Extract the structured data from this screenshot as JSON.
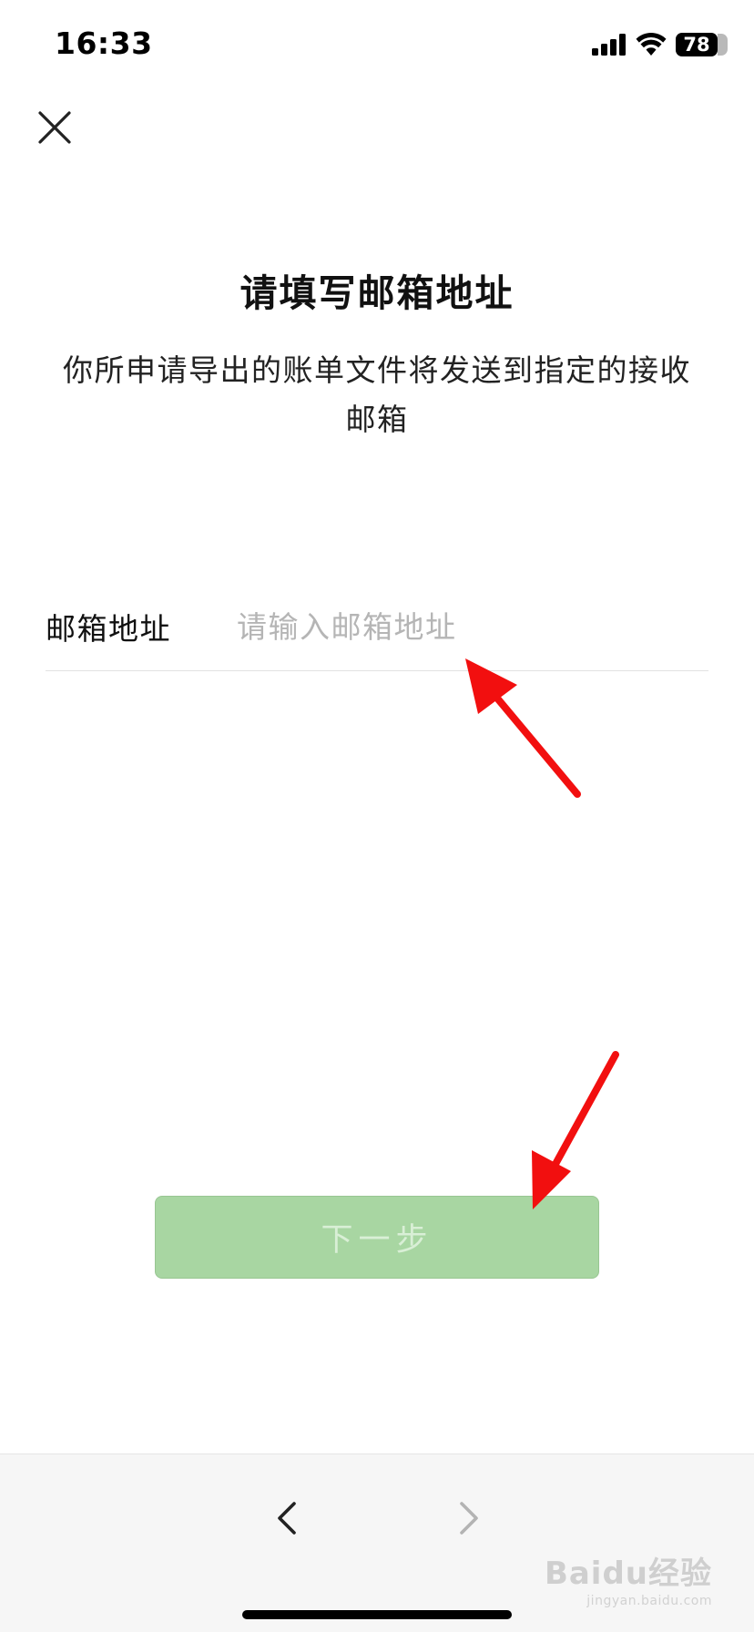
{
  "status_bar": {
    "time": "16:33",
    "battery": "78",
    "icons": [
      "cellular-signal-icon",
      "wifi-icon",
      "battery-icon"
    ]
  },
  "header": {
    "close_icon": "close-icon"
  },
  "title": "请填写邮箱地址",
  "description": "你所申请导出的账单文件将发送到指定的接收邮箱",
  "email_field": {
    "label": "邮箱地址",
    "value": "",
    "placeholder": "请输入邮箱地址"
  },
  "next_button": {
    "label": "下一步",
    "enabled": false
  },
  "bottom_nav": {
    "back_icon": "chevron-left-icon",
    "forward_icon": "chevron-right-icon"
  },
  "watermark": {
    "text": "Baidu经验",
    "sub": "jingyan.baidu.com"
  },
  "colors": {
    "button_disabled": "#a8d6a2",
    "button_text_disabled": "#d9efd6",
    "annotation_arrow": "#f20f0f",
    "bottom_bar": "#f6f6f6"
  }
}
